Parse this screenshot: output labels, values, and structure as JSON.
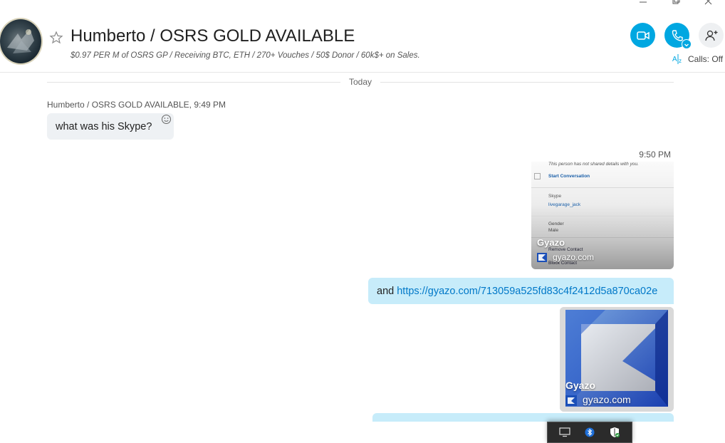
{
  "colors": {
    "accent": "#00a7e1",
    "out_bubble": "#c7ecfa",
    "in_bubble": "#eef1f4",
    "link": "#0078c8"
  },
  "window_controls": {
    "icons": [
      "minimize-icon",
      "restore-icon",
      "close-icon"
    ]
  },
  "header": {
    "title": "Humberto / OSRS GOLD AVAILABLE",
    "subtitle": "$0.97 PER M of OSRS GP / Receiving BTC, ETH / 270+ Vouches / 50$ Donor / 60k$+ on Sales.",
    "calls_label": "Calls: Off",
    "buttons": [
      "video-call-icon",
      "audio-call-icon",
      "add-people-icon"
    ]
  },
  "conversation": {
    "day_separator": "Today",
    "messages": [
      {
        "sender": "Humberto / OSRS GOLD AVAILABLE",
        "time": "9:49 PM",
        "text": "what was his Skype?"
      }
    ],
    "outgoing_time": "9:50 PM",
    "screenshot_preview": {
      "lines": [
        "This person has not shared details with you.",
        "Start Conversation",
        "Skype",
        "livegarage_jack",
        "Gender",
        "Male",
        "Remove Contact",
        "Block Contact"
      ],
      "brand": "Gyazo",
      "domain": "gyazo.com"
    },
    "outgoing_text_prefix": "and ",
    "outgoing_link": "https://gyazo.com/713059a525fd83c4f2412d5a870ca02e",
    "link_preview": {
      "brand": "Gyazo",
      "domain": "gyazo.com"
    }
  },
  "taskbar_tray": {
    "icons": [
      "network-icon",
      "bluetooth-icon",
      "security-shield-icon"
    ]
  }
}
